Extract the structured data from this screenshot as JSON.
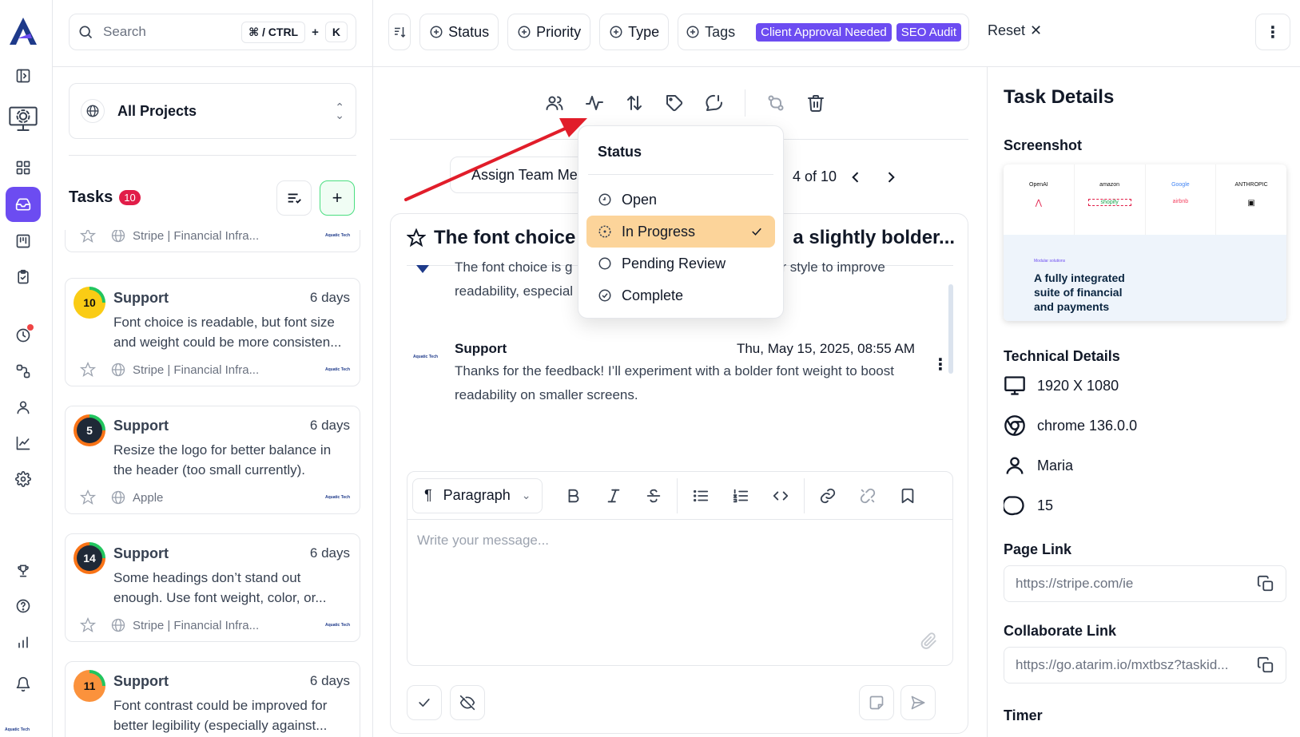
{
  "search": {
    "placeholder": "Search",
    "shortcut_mod": "⌘ / CTRL",
    "shortcut_plus": "+",
    "shortcut_key": "K"
  },
  "filters": {
    "status": "Status",
    "priority": "Priority",
    "type": "Type",
    "tags": "Tags",
    "tag_chips": [
      "Client Approval Needed",
      "SEO Audit"
    ],
    "reset": "Reset"
  },
  "projects": {
    "selected": "All Projects"
  },
  "tasks": {
    "title": "Tasks",
    "count": "10",
    "partial_project": "Stripe | Financial Infra...",
    "items": [
      {
        "num": "10",
        "color": "#facc15",
        "author": "Support",
        "age": "6 days",
        "desc": "Font choice is readable, but font size and weight could be more consisten...",
        "project": "Stripe | Financial Infra..."
      },
      {
        "num": "5",
        "color": "#1f2937",
        "author": "Support",
        "age": "6 days",
        "desc": "Resize the logo for better balance in the header (too small currently).",
        "project": "Apple"
      },
      {
        "num": "14",
        "color": "#1f2937",
        "author": "Support",
        "age": "6 days",
        "desc": "Some headings don’t stand out enough. Use font weight, color, or...",
        "project": "Stripe | Financial Infra..."
      },
      {
        "num": "11",
        "color": "#fb923c",
        "author": "Support",
        "age": "6 days",
        "desc": "Font contrast could be improved for better legibility (especially against...",
        "project": ""
      }
    ]
  },
  "center": {
    "assign_label": "Assign Team Members",
    "pager": "4 of 10",
    "title_left": "The font choice",
    "title_right": "a slightly bolder...",
    "first_msg_line1_left": "The font choice is g",
    "first_msg_line1_right": "r style to improve",
    "first_msg_line2": "readability, especial",
    "reply": {
      "sender": "Support",
      "timestamp": "Thu, May 15, 2025, 08:55 AM",
      "text1": "Thanks for the feedback! I’ll experiment with a bolder font weight to boost",
      "text2": "readability on smaller screens."
    },
    "editor": {
      "block_type": "Paragraph",
      "placeholder": "Write your message..."
    }
  },
  "status_dropdown": {
    "header": "Status",
    "options": [
      "Open",
      "In Progress",
      "Pending Review",
      "Complete"
    ],
    "selected": "In Progress",
    "highlight_color": "#fcd49a"
  },
  "right_panel": {
    "title": "Task Details",
    "screenshot_label": "Screenshot",
    "screenshot_logos": [
      "OpenAI",
      "amazon",
      "Google",
      "ANTHROPIC"
    ],
    "screenshot_sub_logos": [
      "shopify",
      "airbnb"
    ],
    "screenshot_small": "Modular solutions",
    "screenshot_headline": "A fully integrated suite of financial and payments",
    "technical_label": "Technical Details",
    "resolution": "1920 X 1080",
    "browser": "chrome 136.0.0",
    "user": "Maria",
    "count": "15",
    "page_link_label": "Page Link",
    "page_link": "https://stripe.com/ie",
    "collab_label": "Collaborate Link",
    "collab_link": "https://go.atarim.io/mxtbsz?taskid...",
    "timer_label": "Timer"
  },
  "brand_small": "Aquatic Tech",
  "colors": {
    "accent": "#6c4cf1",
    "red": "#e11d48",
    "green_border": "#4ade80"
  }
}
